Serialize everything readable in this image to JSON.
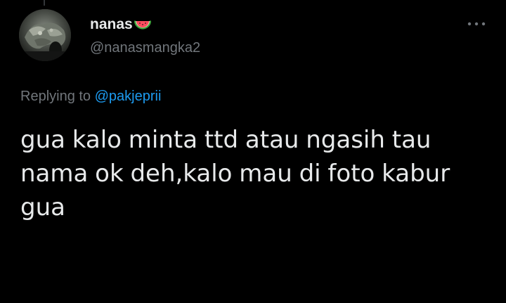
{
  "tweet": {
    "author": {
      "display_name": "nanas",
      "name_emoji": "watermelon-icon",
      "handle": "@nanasmangka2",
      "avatar": "avatar"
    },
    "more_icon": "more-horizontal-icon",
    "reply_prefix": "Replying to",
    "reply_to": "@pakjeprii",
    "text_lines": [
      "gua kalo minta ttd atau ngasih tau",
      "nama ok deh,kalo mau di foto kabur",
      "gua"
    ]
  },
  "colors": {
    "background": "#000000",
    "text_primary": "#e7e9ea",
    "text_secondary": "#71767b",
    "link": "#1d9bf0"
  }
}
